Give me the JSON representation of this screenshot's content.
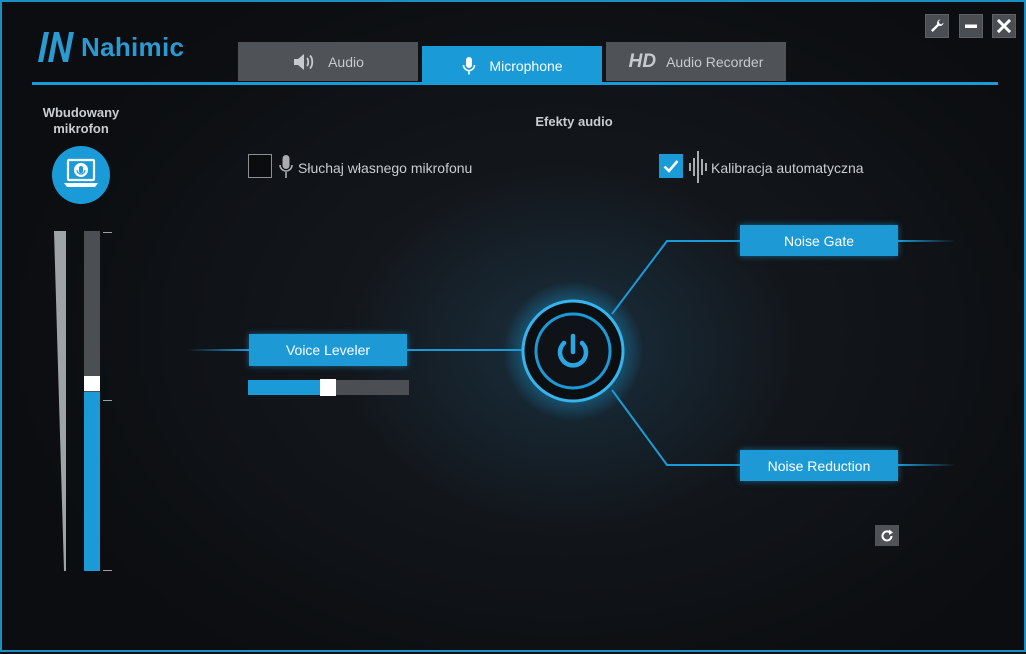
{
  "app": {
    "brand": "Nahimic",
    "brand_color": "#2b9ad2",
    "accent_color": "#1a9bd7"
  },
  "window_controls": [
    {
      "name": "settings",
      "icon": "wrench-icon"
    },
    {
      "name": "minimize",
      "icon": "minimize-icon"
    },
    {
      "name": "close",
      "icon": "close-icon"
    }
  ],
  "tabs": [
    {
      "label": "Audio",
      "icon": "speaker-icon",
      "active": false
    },
    {
      "label": "Microphone",
      "icon": "microphone-icon",
      "active": true
    },
    {
      "label": "Audio Recorder",
      "prefix": "HD",
      "active": false
    }
  ],
  "device": {
    "title": "Wbudowany mikrofon",
    "icon": "laptop-microphone-icon",
    "input_level": 0.0,
    "volume_level": 0.52
  },
  "effects": {
    "title": "Efekty audio",
    "listen": {
      "label": "Słuchaj własnego mikrofonu",
      "checked": false,
      "icon": "microphone-icon"
    },
    "auto_calibration": {
      "label": "Kalibracja automatyczna",
      "checked": true,
      "icon": "waveform-icon"
    },
    "voice_leveler": {
      "label": "Voice Leveler",
      "level": 0.5
    },
    "noise_gate": {
      "label": "Noise Gate"
    },
    "noise_reduction": {
      "label": "Noise Reduction"
    },
    "power": {
      "icon": "power-icon",
      "on": true
    },
    "reset": {
      "icon": "refresh-icon"
    }
  }
}
